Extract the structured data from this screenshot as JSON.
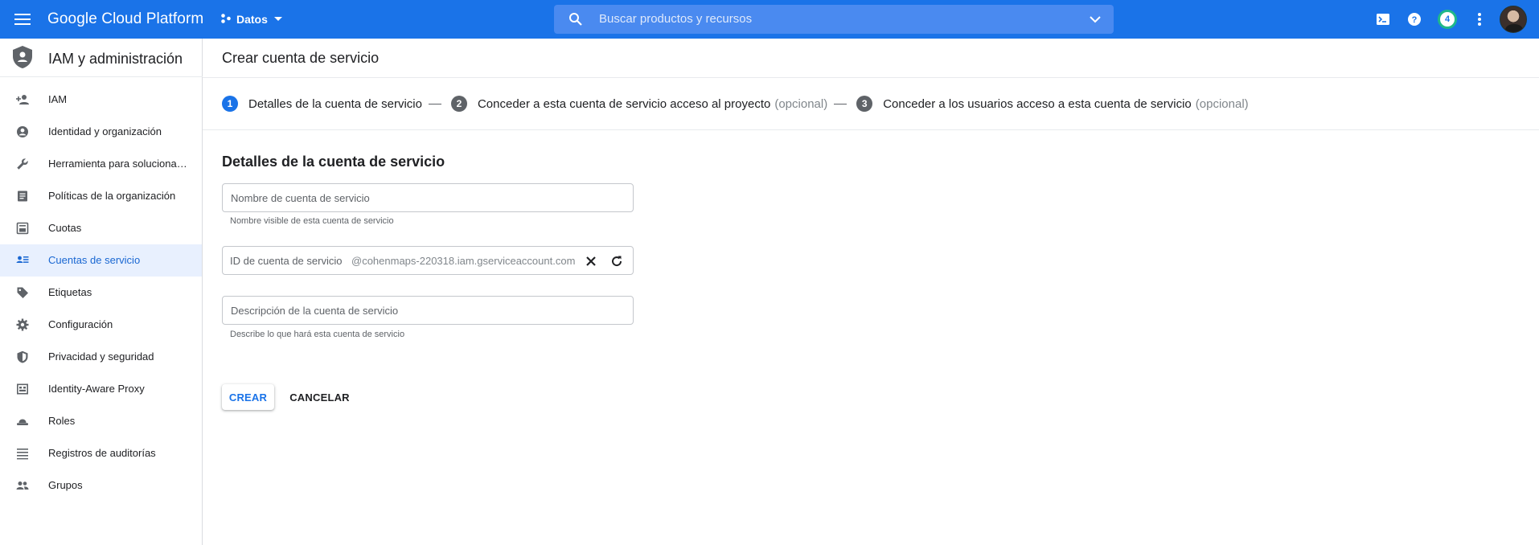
{
  "topbar": {
    "brand": "Google Cloud Platform",
    "project": "Datos",
    "search_placeholder": "Buscar productos y recursos",
    "notifications_count": "4",
    "accent": "#1a73e8"
  },
  "sidebar": {
    "title": "IAM y administración",
    "items": [
      {
        "label": "IAM",
        "icon": "person-add-icon"
      },
      {
        "label": "Identidad y organización",
        "icon": "account-circle-icon"
      },
      {
        "label": "Herramienta para solucionar problemas de políticas",
        "icon": "wrench-icon"
      },
      {
        "label": "Políticas de la organización",
        "icon": "document-icon"
      },
      {
        "label": "Cuotas",
        "icon": "quota-icon"
      },
      {
        "label": "Cuentas de servicio",
        "icon": "service-account-icon",
        "active": true
      },
      {
        "label": "Etiquetas",
        "icon": "tag-icon"
      },
      {
        "label": "Configuración",
        "icon": "gear-icon"
      },
      {
        "label": "Privacidad y seguridad",
        "icon": "shield-icon"
      },
      {
        "label": "Identity-Aware Proxy",
        "icon": "proxy-icon"
      },
      {
        "label": "Roles",
        "icon": "hat-icon"
      },
      {
        "label": "Registros de auditorías",
        "icon": "list-icon"
      },
      {
        "label": "Grupos",
        "icon": "group-icon"
      }
    ]
  },
  "main": {
    "page_title": "Crear cuenta de servicio",
    "steps": [
      {
        "num": "1",
        "label": "Detalles de la cuenta de servicio",
        "optional": ""
      },
      {
        "num": "2",
        "label": "Conceder a esta cuenta de servicio acceso al proyecto",
        "optional": "(opcional)"
      },
      {
        "num": "3",
        "label": "Conceder a los usuarios acceso a esta cuenta de servicio",
        "optional": "(opcional)"
      }
    ],
    "section_title": "Detalles de la cuenta de servicio",
    "name_field": {
      "placeholder": "Nombre de cuenta de servicio",
      "helper": "Nombre visible de esta cuenta de servicio"
    },
    "id_field": {
      "label": "ID de cuenta de servicio",
      "suffix": "@cohenmaps-220318.iam.gserviceaccount.com"
    },
    "description_field": {
      "placeholder": "Descripción de la cuenta de servicio",
      "helper": "Describe lo que hará esta cuenta de servicio"
    },
    "create_label": "CREAR",
    "cancel_label": "CANCELAR"
  }
}
